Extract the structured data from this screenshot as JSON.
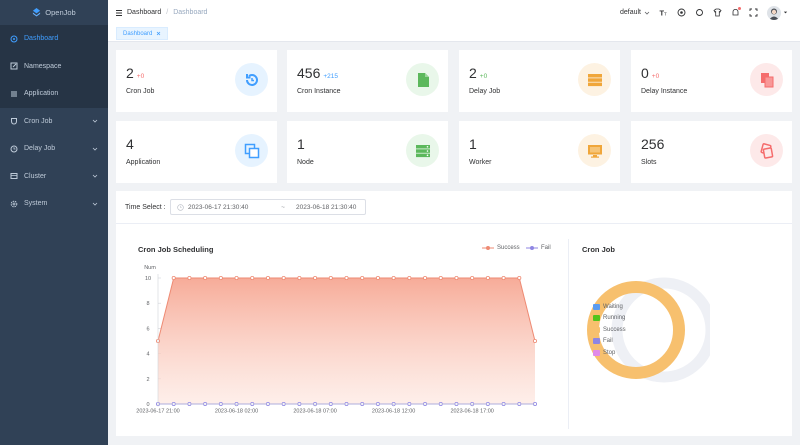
{
  "app": {
    "name": "OpenJob"
  },
  "sidebar": {
    "items": [
      {
        "label": "Dashboard",
        "icon": "dashboard-icon",
        "active": true
      },
      {
        "label": "Namespace",
        "icon": "namespace-icon"
      },
      {
        "label": "Application",
        "icon": "list-icon"
      },
      {
        "label": "Cron Job",
        "icon": "clock-icon",
        "expandable": true
      },
      {
        "label": "Delay Job",
        "icon": "timer-icon",
        "expandable": true
      },
      {
        "label": "Cluster",
        "icon": "cluster-icon",
        "expandable": true
      },
      {
        "label": "System",
        "icon": "settings-icon",
        "expandable": true
      }
    ]
  },
  "header": {
    "breadcrumb": [
      "Dashboard",
      "Dashboard"
    ],
    "namespace": "default"
  },
  "tags": [
    {
      "label": "Dashboard"
    }
  ],
  "stats": [
    {
      "value": "2",
      "delta": "+0",
      "label": "Cron Job",
      "icon": "refresh-clock-icon",
      "color": "#409eff",
      "bg": "#e6f3ff"
    },
    {
      "value": "456",
      "delta": "+215",
      "label": "Cron Instance",
      "icon": "document-icon",
      "color": "#5cb85c",
      "bg": "#e9f7ea"
    },
    {
      "value": "2",
      "delta": "+0",
      "label": "Delay Job",
      "icon": "stack-icon",
      "color": "#f0a63a",
      "bg": "#fdf2e2"
    },
    {
      "value": "0",
      "delta": "+0",
      "label": "Delay Instance",
      "icon": "copy-icon",
      "color": "#f56c6c",
      "bg": "#fde9e9"
    },
    {
      "value": "4",
      "delta": "",
      "label": "Application",
      "icon": "windows-icon",
      "color": "#409eff",
      "bg": "#e6f3ff"
    },
    {
      "value": "1",
      "delta": "",
      "label": "Node",
      "icon": "server-icon",
      "color": "#5cb85c",
      "bg": "#e9f7ea"
    },
    {
      "value": "1",
      "delta": "",
      "label": "Worker",
      "icon": "monitor-icon",
      "color": "#f0a63a",
      "bg": "#fdf2e2"
    },
    {
      "value": "256",
      "delta": "",
      "label": "Slots",
      "icon": "slots-icon",
      "color": "#f56c6c",
      "bg": "#fde9e9"
    }
  ],
  "filter": {
    "label": "Time Select :",
    "start": "2023-06-17 21:30:40",
    "separator": "~",
    "end": "2023-06-18 21:30:40"
  },
  "colors": {
    "success": "#ee8a73",
    "fail": "#8f86e3",
    "waiting": "#5b9bf0",
    "running": "#52c41a",
    "success_pie": "#f7c06e",
    "stop": "#e08ae8"
  },
  "chart_data": [
    {
      "type": "area",
      "title": "Cron Job Scheduling",
      "ylabel": "Num",
      "ylim": [
        0,
        10
      ],
      "yticks": [
        0,
        2,
        4,
        6,
        8,
        10
      ],
      "xtick_labels": [
        "2023-06-17 21:00",
        "2023-06-18 02:00",
        "2023-06-18 07:00",
        "2023-06-18 12:00",
        "2023-06-18 17:00"
      ],
      "x_count": 25,
      "series": [
        {
          "name": "Success",
          "values": [
            5,
            10,
            10,
            10,
            10,
            10,
            10,
            10,
            10,
            10,
            10,
            10,
            10,
            10,
            10,
            10,
            10,
            10,
            10,
            10,
            10,
            10,
            10,
            10,
            5
          ]
        },
        {
          "name": "Fail",
          "values": [
            0,
            0,
            0,
            0,
            0,
            0,
            0,
            0,
            0,
            0,
            0,
            0,
            0,
            0,
            0,
            0,
            0,
            0,
            0,
            0,
            0,
            0,
            0,
            0,
            0
          ]
        }
      ],
      "legend": "top-right"
    },
    {
      "type": "pie",
      "title": "Cron Job",
      "categories": [
        "Waiting",
        "Running",
        "Success",
        "Fail",
        "Stop"
      ],
      "values": [
        0,
        0,
        456,
        0,
        0
      ],
      "legend": "right"
    }
  ]
}
